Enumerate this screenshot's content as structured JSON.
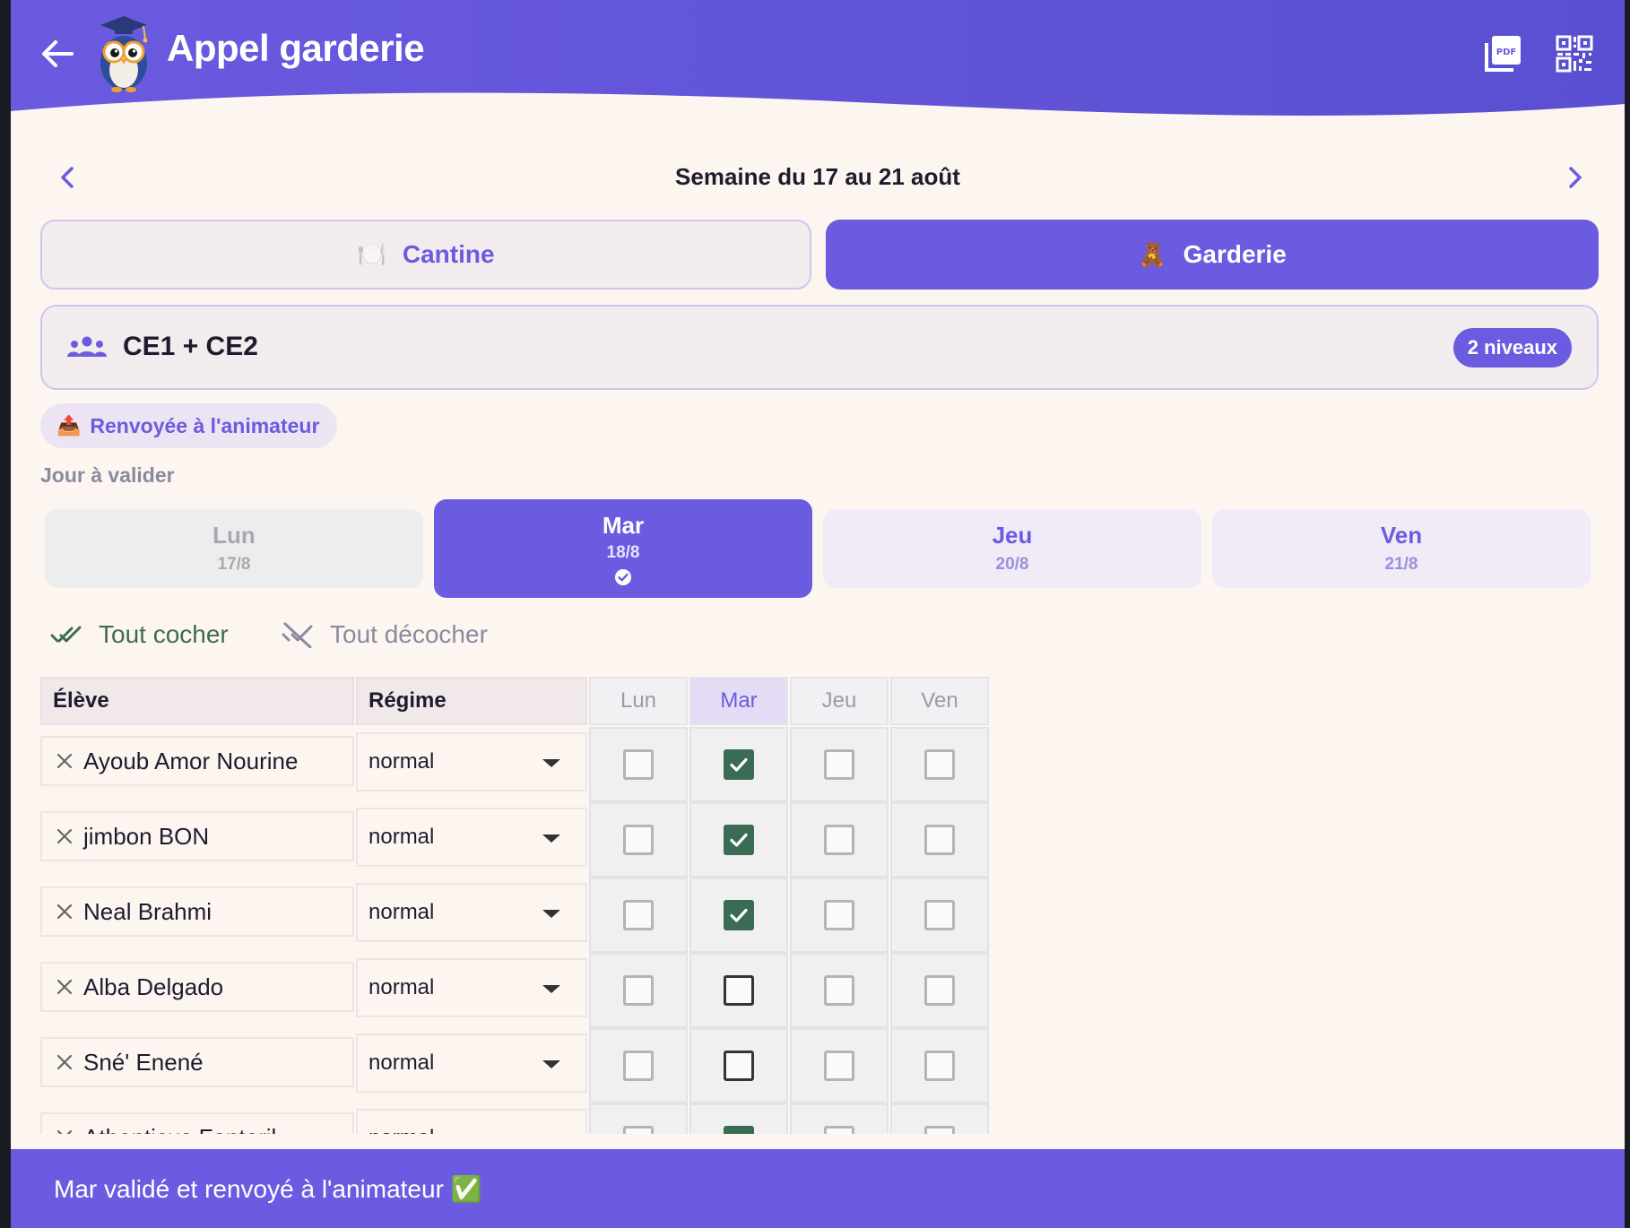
{
  "header": {
    "title": "Appel garderie"
  },
  "week": {
    "label": "Semaine du 17 au 21 août"
  },
  "services": {
    "cantine": {
      "emoji": "🍽️",
      "label": "Cantine",
      "selected": false
    },
    "garderie": {
      "emoji": "🧸",
      "label": "Garderie",
      "selected": true
    }
  },
  "class_selector": {
    "label": "CE1 + CE2",
    "badge": "2 niveaux"
  },
  "status_chip": {
    "emoji": "📤",
    "label": "Renvoyée à l'animateur"
  },
  "day_section": {
    "label": "Jour à valider"
  },
  "days": [
    {
      "name": "Lun",
      "date": "17/8",
      "state": "disabled"
    },
    {
      "name": "Mar",
      "date": "18/8",
      "state": "selected-validated"
    },
    {
      "name": "Jeu",
      "date": "20/8",
      "state": "available"
    },
    {
      "name": "Ven",
      "date": "21/8",
      "state": "available"
    }
  ],
  "bulk_actions": {
    "check_all": "Tout cocher",
    "uncheck_all": "Tout décocher"
  },
  "table": {
    "headers": {
      "student": "Élève",
      "regime": "Régime",
      "days": [
        "Lun",
        "Mar",
        "Jeu",
        "Ven"
      ]
    },
    "active_day": "Mar",
    "rows": [
      {
        "name": "Ayoub Amor Nourine",
        "regime": "normal",
        "checks": [
          false,
          true,
          false,
          false
        ]
      },
      {
        "name": "jimbon BON",
        "regime": "normal",
        "checks": [
          false,
          true,
          false,
          false
        ]
      },
      {
        "name": "Neal Brahmi",
        "regime": "normal",
        "checks": [
          false,
          true,
          false,
          false
        ]
      },
      {
        "name": "Alba Delgado",
        "regime": "normal",
        "checks": [
          false,
          false,
          false,
          false
        ]
      },
      {
        "name": "Sné' Enené",
        "regime": "normal",
        "checks": [
          false,
          false,
          false,
          false
        ]
      },
      {
        "name": "Athenticus Fontoril",
        "regime": "normal",
        "checks": [
          false,
          true,
          false,
          false
        ]
      }
    ]
  },
  "snackbar": {
    "message": "Mar validé et renvoyé à l'animateur ✅"
  },
  "colors": {
    "primary": "#6b5be0",
    "check_green": "#3a6b55",
    "background": "#fdf6f0"
  }
}
